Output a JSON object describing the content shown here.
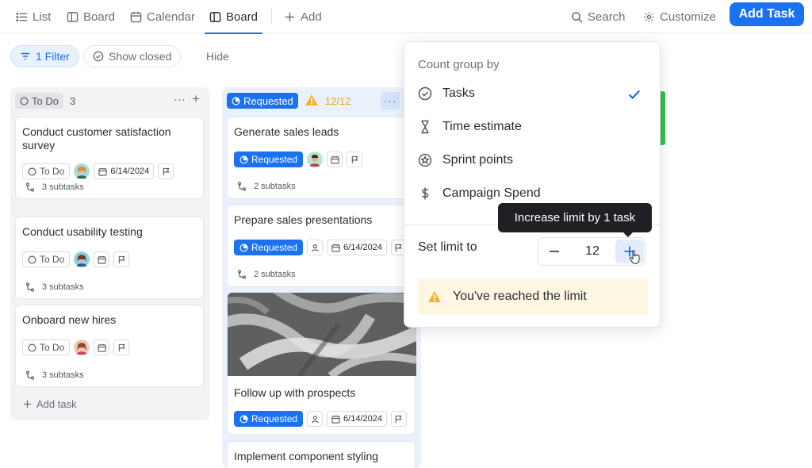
{
  "nav": {
    "tabs": [
      {
        "label": "List",
        "icon": "list-icon"
      },
      {
        "label": "Board",
        "icon": "board-icon"
      },
      {
        "label": "Calendar",
        "icon": "calendar-icon"
      },
      {
        "label": "Board",
        "icon": "board-icon",
        "active": true
      }
    ],
    "add_label": "Add",
    "search_label": "Search",
    "customize_label": "Customize",
    "add_task_label": "Add Task"
  },
  "filters": {
    "filter_label": "1 Filter",
    "show_closed_label": "Show closed",
    "hide_label": "Hide"
  },
  "columns": {
    "todo": {
      "status": "To Do",
      "count": "3",
      "add_task_label": "Add task",
      "cards": [
        {
          "title": "Conduct customer satisfaction survey",
          "status": "To Do",
          "date": "6/14/2024",
          "subtasks": "3 subtasks"
        },
        {
          "title": "Conduct usability testing",
          "status": "To Do",
          "subtasks": "3 subtasks"
        },
        {
          "title": "Onboard new hires",
          "status": "To Do",
          "subtasks": "3 subtasks"
        }
      ]
    },
    "requested": {
      "status": "Requested",
      "count": "12/12",
      "cards": [
        {
          "title": "Generate sales leads",
          "status": "Requested",
          "subtasks": "2 subtasks"
        },
        {
          "title": "Prepare sales presentations",
          "status": "Requested",
          "date": "6/14/2024",
          "subtasks": "2 subtasks"
        },
        {
          "title": "Follow up with prospects",
          "status": "Requested",
          "date": "6/14/2024"
        },
        {
          "title": "Implement component styling"
        }
      ]
    }
  },
  "dropdown": {
    "heading": "Count group by",
    "options": [
      {
        "label": "Tasks",
        "icon": "check-circle-icon",
        "selected": true
      },
      {
        "label": "Time estimate",
        "icon": "hourglass-icon"
      },
      {
        "label": "Sprint points",
        "icon": "sprint-star-icon"
      },
      {
        "label": "Campaign Spend",
        "icon": "dollar-icon"
      }
    ],
    "set_limit_label": "Set limit to",
    "limit_value": "12",
    "limit_message": "You've reached the limit"
  },
  "tooltip": {
    "text": "Increase limit by 1 task"
  },
  "colors": {
    "accent": "#1b72f0",
    "warning": "#e3a41c",
    "todo_bg": "#f2f3f5",
    "requested_bg": "#eaf1fd",
    "limit_bg": "#fdf6e0",
    "green": "#30c24b"
  }
}
